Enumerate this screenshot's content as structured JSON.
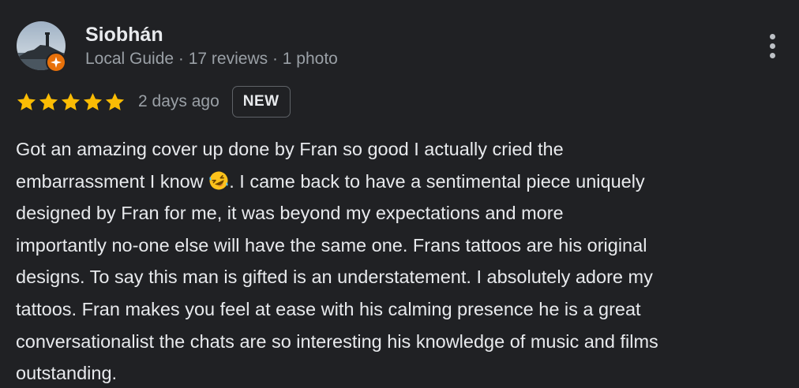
{
  "review": {
    "author": {
      "name": "Siobhán",
      "meta": "Local Guide · 17 reviews · 1 photo",
      "avatar_icon": "lighthouse-photo-avatar",
      "badge_icon": "local-guide-badge-icon"
    },
    "rating": {
      "stars": 5,
      "max": 5,
      "star_color": "#fbbc04"
    },
    "date": "2 days ago",
    "badge": "NEW",
    "text_lines": [
      "Got an amazing cover up done by Fran so good I actually cried the",
      "embarrassment I know ",
      ". I came back to have a sentimental piece uniquely",
      "designed by Fran for me, it was beyond my expectations and more",
      "importantly no-one else will have the same one. Frans tattoos are his original",
      "designs. To say this man is gifted is an understatement. I absolutely adore my",
      "tattoos. Fran makes you feel at ease with his calming presence he is a great",
      "conversationalist the chats are so interesting his knowledge of music and films",
      "outstanding."
    ],
    "emoji_icon": "rolling-on-floor-laughing-emoji",
    "more_icon": "more-vert-icon"
  },
  "colors": {
    "background": "#202124",
    "text_primary": "#e8eaed",
    "text_secondary": "#9aa0a6",
    "guide_badge": "#e8710a"
  }
}
